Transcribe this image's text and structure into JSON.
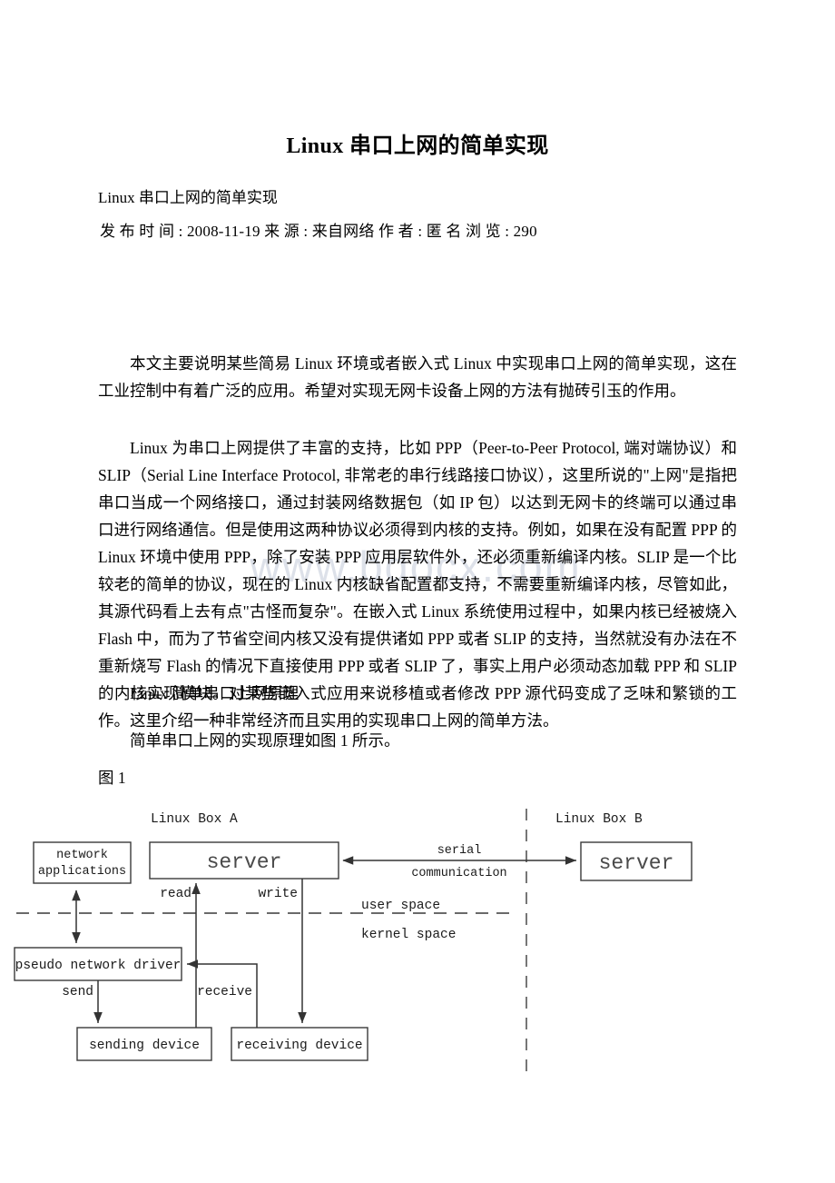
{
  "document": {
    "title": "Linux 串口上网的简单实现",
    "subtitle": "Linux 串口上网的简单实现",
    "meta": {
      "publish_label": "发 布 时 间 :",
      "publish_date": "2008-11-19",
      "source_label": "来 源 :",
      "source_value": "来自网络",
      "author_label": "作 者 :",
      "author_value": "匿 名",
      "views_label": "浏 览 :",
      "views_value": "290",
      "line": "发 布 时 间 : 2008-11-19   来 源 : 来自网络    作 者 : 匿 名   浏 览 : 290"
    },
    "watermark": "www.bdocx.com",
    "paragraphs": {
      "p1": "本文主要说明某些简易 Linux 环境或者嵌入式 Linux 中实现串口上网的简单实现，这在工业控制中有着广泛的应用。希望对实现无网卡设备上网的方法有抛砖引玉的作用。",
      "p2": "Linux 为串口上网提供了丰富的支持，比如 PPP（Peer-to-Peer Protocol, 端对端协议）和 SLIP（Serial Line Interface Protocol, 非常老的串行线路接口协议），这里所说的\"上网\"是指把串口当成一个网络接口，通过封装网络数据包（如 IP 包）以达到无网卡的终端可以通过串口进行网络通信。但是使用这两种协议必须得到内核的支持。例如，如果在没有配置 PPP 的 Linux 环境中使用 PPP，除了安装 PPP 应用层软件外，还必须重新编译内核。SLIP 是一个比较老的简单的协议，现在的 Linux 内核缺省配置都支持，不需要重新编译内核，尽管如此，其源代码看上去有点\"古怪而复杂\"。在嵌入式 Linux 系统使用过程中，如果内核已经被烧入 Flash 中，而为了节省空间内核又没有提供诸如 PPP 或者 SLIP 的支持，当然就没有办法在不重新烧写 Flash 的情况下直接使用 PPP 或者 SLIP 了，事实上用户必须动态加载 PPP 和 SLIP 的内核实现模块。对某些嵌入式应用来说移植或者修改 PPP 源代码变成了乏味和繁锁的工作。这里介绍一种非常经济而且实用的实现串口上网的简单方法。",
      "p3": "Linux 简单串口上网原理",
      "p4": "简单串口上网的实现原理如图 1 所示。"
    },
    "figure_caption": "图 1"
  },
  "figure": {
    "labels": {
      "box_a": "Linux Box A",
      "box_b": "Linux Box B",
      "network_applications_line1": "network",
      "network_applications_line2": "applications",
      "server_a": "server",
      "server_b": "server",
      "pseudo_network_driver": "pseudo network driver",
      "sending_device": "sending device",
      "receiving_device": "receiving device",
      "read": "read",
      "write": "write",
      "send": "send",
      "receive": "receive",
      "serial_line1": "serial",
      "serial_line2": "communication",
      "user_space": "user space",
      "kernel_space": "kernel space"
    }
  },
  "colors": {
    "text": "#000000",
    "watermark": "#d8dce6",
    "stroke": "#404040",
    "page_background": "#ffffff"
  }
}
